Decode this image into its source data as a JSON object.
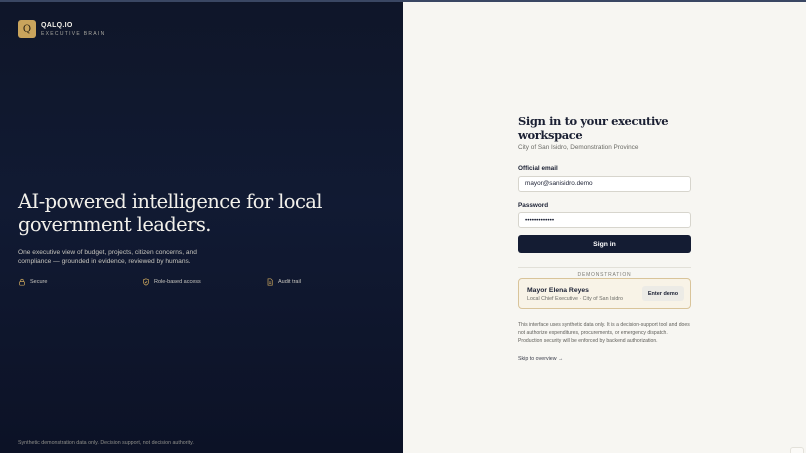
{
  "brand": {
    "logo_letter": "Q",
    "name": "QALQ.IO",
    "tagline": "EXECUTIVE BRAIN",
    "accent_color": "#c9a45c"
  },
  "hero": {
    "headline": "AI-powered intelligence for local government leaders.",
    "lede": "One executive view of budget, projects, citizen concerns, and compliance — grounded in evidence, reviewed by humans."
  },
  "features": [
    {
      "icon": "lock-icon",
      "label": "Secure"
    },
    {
      "icon": "shield-check-icon",
      "label": "Role-based access"
    },
    {
      "icon": "document-icon",
      "label": "Audit trail"
    }
  ],
  "left_footnote": "Synthetic demonstration data only. Decision support, not decision authority.",
  "form": {
    "title": "Sign in to your executive workspace",
    "subtitle": "City of San Isidro, Demonstration Province",
    "email_label": "Official email",
    "email_value": "mayor@sanisidro.demo",
    "password_label": "Password",
    "password_value": "demopassword1",
    "signin_label": "Sign in",
    "divider_label": "DEMONSTRATION",
    "demo": {
      "name": "Mayor Elena Reyes",
      "role": "Local Chief Executive · City of San Isidro",
      "button_label": "Enter demo"
    },
    "disclaimer": "This interface uses synthetic data only. It is a decision-support tool and does not authorize expenditures, procurements, or emergency dispatch. Production security will be enforced by backend authorization.",
    "skip_label": "Skip to overview →"
  },
  "colors": {
    "left_bg": "#0f1629",
    "right_bg": "#f7f6f2",
    "primary_button": "#141c33",
    "demo_card_border": "#d9c49a"
  }
}
